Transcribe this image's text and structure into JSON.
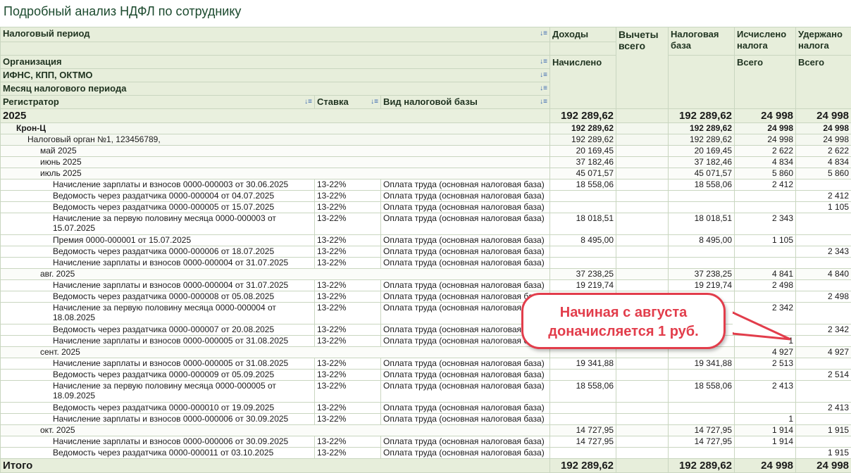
{
  "title": "Подробный анализ НДФЛ по сотруднику",
  "header": {
    "tax_period": "Налоговый период",
    "organization": "Организация",
    "ifns": "ИФНС, КПП, ОКТМО",
    "month": "Месяц налогового периода",
    "registrar": "Регистратор",
    "rate": "Ставка",
    "base_type": "Вид налоговой базы",
    "income": "Доходы",
    "accrued": "Начислено",
    "deductions": "Вычеты всего",
    "tax_base": "Налоговая база",
    "calculated": "Исчислено налога",
    "calculated_total": "Всего",
    "withheld": "Удержано налога",
    "withheld_total": "Всего",
    "sort_icon": "sort-icon"
  },
  "rows": [
    {
      "type": "grp",
      "label": "2025",
      "income": "192 289,62",
      "base": "192 289,62",
      "calc": "24 998",
      "withheld": "24 998"
    },
    {
      "type": "org",
      "label": "Крон-Ц",
      "income": "192 289,62",
      "base": "192 289,62",
      "calc": "24 998",
      "withheld": "24 998"
    },
    {
      "type": "ifns",
      "label": "Налоговый орган №1, 123456789,",
      "income": "192 289,62",
      "base": "192 289,62",
      "calc": "24 998",
      "withheld": "24 998"
    },
    {
      "type": "month",
      "label": "май 2025",
      "income": "20 169,45",
      "base": "20 169,45",
      "calc": "2 622",
      "withheld": "2 622"
    },
    {
      "type": "month",
      "label": "июнь 2025",
      "income": "37 182,46",
      "base": "37 182,46",
      "calc": "4 834",
      "withheld": "4 834"
    },
    {
      "type": "month",
      "label": "июль 2025",
      "income": "45 071,57",
      "base": "45 071,57",
      "calc": "5 860",
      "withheld": "5 860"
    },
    {
      "type": "doc",
      "label": "Начисление зарплаты и взносов 0000-000003 от 30.06.2025",
      "rate": "13-22%",
      "kind": "Оплата труда (основная налоговая база)",
      "income": "18 558,06",
      "base": "18 558,06",
      "calc": "2 412",
      "withheld": ""
    },
    {
      "type": "doc",
      "label": "Ведомость через раздатчика 0000-000004 от 04.07.2025",
      "rate": "13-22%",
      "kind": "Оплата труда (основная налоговая база)",
      "income": "",
      "base": "",
      "calc": "",
      "withheld": "2 412"
    },
    {
      "type": "doc",
      "label": "Ведомость через раздатчика 0000-000005 от 15.07.2025",
      "rate": "13-22%",
      "kind": "Оплата труда (основная налоговая база)",
      "income": "",
      "base": "",
      "calc": "",
      "withheld": "1 105"
    },
    {
      "type": "doc2",
      "label": "Начисление за первую половину месяца 0000-000003 от 15.07.2025",
      "rate": "13-22%",
      "kind": "Оплата труда (основная налоговая база)",
      "income": "18 018,51",
      "base": "18 018,51",
      "calc": "2 343",
      "withheld": ""
    },
    {
      "type": "doc",
      "label": "Премия 0000-000001 от 15.07.2025",
      "rate": "13-22%",
      "kind": "Оплата труда (основная налоговая база)",
      "income": "8 495,00",
      "base": "8 495,00",
      "calc": "1 105",
      "withheld": ""
    },
    {
      "type": "doc",
      "label": "Ведомость через раздатчика 0000-000006 от 18.07.2025",
      "rate": "13-22%",
      "kind": "Оплата труда (основная налоговая база)",
      "income": "",
      "base": "",
      "calc": "",
      "withheld": "2 343"
    },
    {
      "type": "doc",
      "label": "Начисление зарплаты и взносов 0000-000004 от 31.07.2025",
      "rate": "13-22%",
      "kind": "Оплата труда (основная налоговая база)",
      "income": "",
      "base": "",
      "calc": "",
      "withheld": ""
    },
    {
      "type": "month",
      "label": "авг. 2025",
      "income": "37 238,25",
      "base": "37 238,25",
      "calc": "4 841",
      "withheld": "4 840"
    },
    {
      "type": "doc",
      "label": "Начисление зарплаты и взносов 0000-000004 от 31.07.2025",
      "rate": "13-22%",
      "kind": "Оплата труда (основная налоговая база)",
      "income": "19 219,74",
      "base": "19 219,74",
      "calc": "2 498",
      "withheld": ""
    },
    {
      "type": "doc",
      "label": "Ведомость через раздатчика 0000-000008 от 05.08.2025",
      "rate": "13-22%",
      "kind": "Оплата труда (основная налоговая база)",
      "income": "",
      "base": "",
      "calc": "",
      "withheld": "2 498"
    },
    {
      "type": "doc2",
      "label": "Начисление за первую половину месяца 0000-000004 от 18.08.2025",
      "rate": "13-22%",
      "kind": "Оплата труда (основная налоговая база)",
      "income": "",
      "base": "",
      "calc": "2 342",
      "withheld": ""
    },
    {
      "type": "doc",
      "label": "Ведомость через раздатчика 0000-000007 от 20.08.2025",
      "rate": "13-22%",
      "kind": "Оплата труда (основная налоговая база)",
      "income": "",
      "base": "",
      "calc": "",
      "withheld": "2 342"
    },
    {
      "type": "doc",
      "label": "Начисление зарплаты и взносов 0000-000005 от 31.08.2025",
      "rate": "13-22%",
      "kind": "Оплата труда (основная налоговая база)",
      "income": "",
      "base": "",
      "calc": "1",
      "withheld": ""
    },
    {
      "type": "month",
      "label": "сент. 2025",
      "income": "",
      "base": "",
      "calc": "4 927",
      "withheld": "4 927"
    },
    {
      "type": "doc",
      "label": "Начисление зарплаты и взносов 0000-000005 от 31.08.2025",
      "rate": "13-22%",
      "kind": "Оплата труда (основная налоговая база)",
      "income": "19 341,88",
      "base": "19 341,88",
      "calc": "2 513",
      "withheld": ""
    },
    {
      "type": "doc",
      "label": "Ведомость через раздатчика 0000-000009 от 05.09.2025",
      "rate": "13-22%",
      "kind": "Оплата труда (основная налоговая база)",
      "income": "",
      "base": "",
      "calc": "",
      "withheld": "2 514"
    },
    {
      "type": "doc2",
      "label": "Начисление за первую половину месяца 0000-000005 от 18.09.2025",
      "rate": "13-22%",
      "kind": "Оплата труда (основная налоговая база)",
      "income": "18 558,06",
      "base": "18 558,06",
      "calc": "2 413",
      "withheld": ""
    },
    {
      "type": "doc",
      "label": "Ведомость через раздатчика 0000-000010 от 19.09.2025",
      "rate": "13-22%",
      "kind": "Оплата труда (основная налоговая база)",
      "income": "",
      "base": "",
      "calc": "",
      "withheld": "2 413"
    },
    {
      "type": "doc",
      "label": "Начисление зарплаты и взносов 0000-000006 от 30.09.2025",
      "rate": "13-22%",
      "kind": "Оплата труда (основная налоговая база)",
      "income": "",
      "base": "",
      "calc": "1",
      "withheld": ""
    },
    {
      "type": "month",
      "label": "окт. 2025",
      "income": "14 727,95",
      "base": "14 727,95",
      "calc": "1 914",
      "withheld": "1 915"
    },
    {
      "type": "doc",
      "label": "Начисление зарплаты и взносов 0000-000006 от 30.09.2025",
      "rate": "13-22%",
      "kind": "Оплата труда (основная налоговая база)",
      "income": "14 727,95",
      "base": "14 727,95",
      "calc": "1 914",
      "withheld": ""
    },
    {
      "type": "doc",
      "label": "Ведомость через раздатчика 0000-000011 от 03.10.2025",
      "rate": "13-22%",
      "kind": "Оплата труда (основная налоговая база)",
      "income": "",
      "base": "",
      "calc": "",
      "withheld": "1 915"
    }
  ],
  "total": {
    "label": "Итого",
    "income": "192 289,62",
    "base": "192 289,62",
    "calc": "24 998",
    "withheld": "24 998"
  },
  "callout": {
    "line1": "Начиная с августа",
    "line2": "доначисляется 1 руб."
  },
  "colors": {
    "accent": "#e23d4b",
    "header_bg": "#e7eedb",
    "title": "#1c4a2e"
  }
}
